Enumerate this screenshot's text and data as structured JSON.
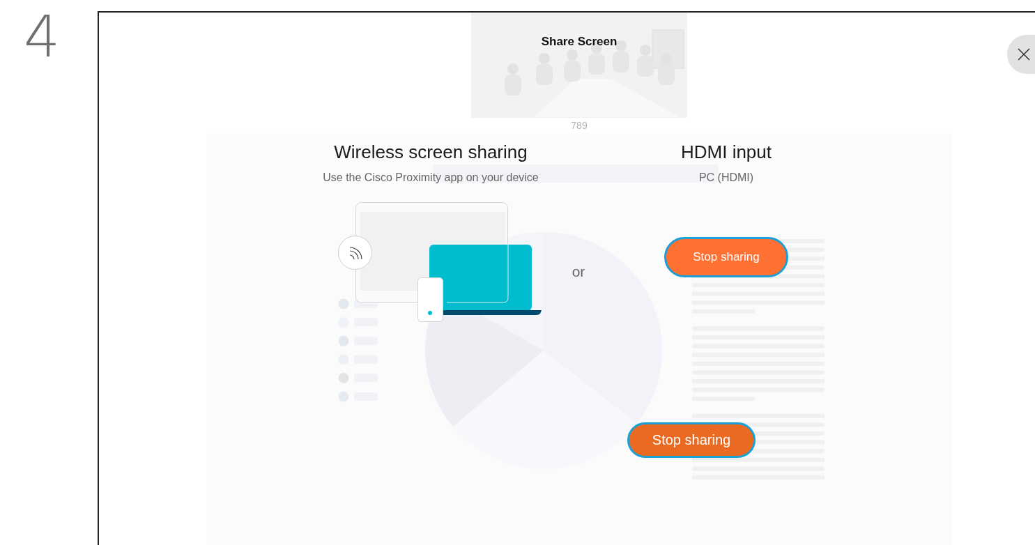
{
  "step_number": "4",
  "dialog": {
    "title": "Share Screen",
    "thumbnail": {
      "kind": "picture",
      "caption": "789"
    },
    "wireless": {
      "title": "Wireless screen sharing",
      "subtitle": "Use the Cisco Proximity app on your device"
    },
    "separator": "or",
    "hdmi": {
      "title": "HDMI input",
      "source": "PC (HDMI)",
      "button": "Stop sharing"
    },
    "stop_button": "Stop sharing"
  }
}
